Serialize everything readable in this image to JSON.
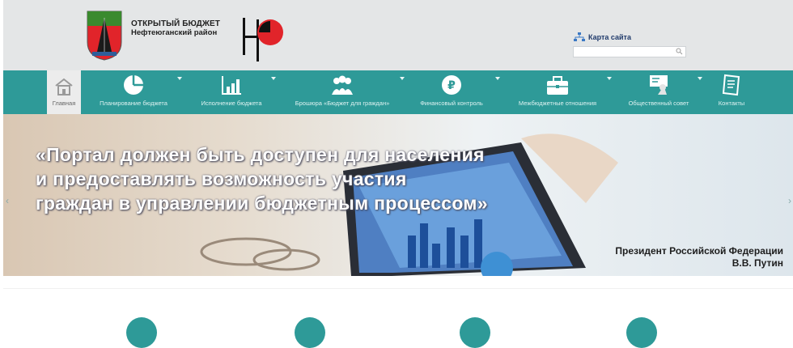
{
  "header": {
    "title": "ОТКРЫТЫЙ БЮДЖЕТ",
    "subtitle": "Нефтеюганский район",
    "sitemap_label": "Карта сайта",
    "search_placeholder": ""
  },
  "nav": {
    "items": [
      {
        "label": "Главная",
        "icon": "home-icon"
      },
      {
        "label": "Планирование бюджета",
        "icon": "pie-chart-icon"
      },
      {
        "label": "Исполнение бюджета",
        "icon": "bar-chart-icon"
      },
      {
        "label": "Брошюра «Бюджет для граждан»",
        "icon": "people-icon"
      },
      {
        "label": "Финансовый контроль",
        "icon": "ruble-icon"
      },
      {
        "label": "Межбюджетные отношения",
        "icon": "briefcase-icon"
      },
      {
        "label": "Общественный совет",
        "icon": "speaker-icon"
      },
      {
        "label": "Контакты",
        "icon": "notepad-icon"
      }
    ]
  },
  "banner": {
    "quote_lines": [
      "«Портал должен быть доступен для населения",
      "и предоставлять возможность участия",
      "граждан в управлении бюджетным процессом»"
    ],
    "author_line1": "Президент Российской Федерации",
    "author_line2": "В.В. Путин"
  },
  "colors": {
    "nav_bg": "#2e9a98",
    "header_bg": "#e4e6e7",
    "logo_red": "#e1242a",
    "emblem_green": "#3a8a2e"
  }
}
